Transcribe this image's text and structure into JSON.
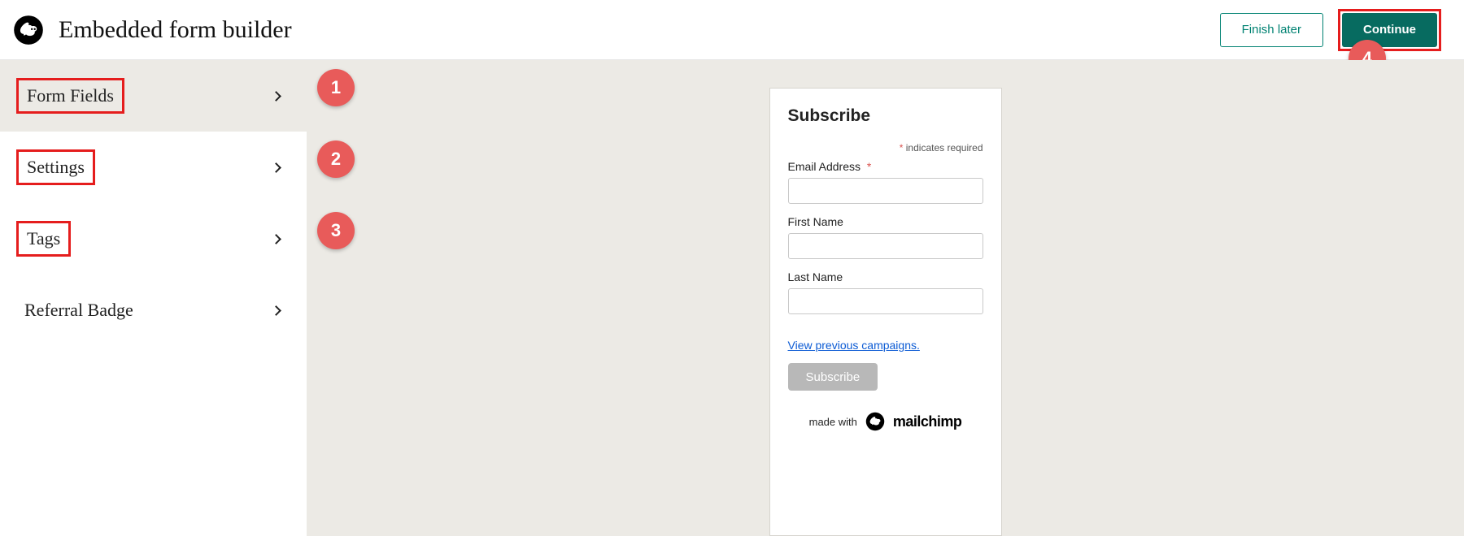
{
  "header": {
    "title": "Embedded form builder",
    "finish_label": "Finish later",
    "continue_label": "Continue"
  },
  "sidebar": {
    "items": [
      {
        "label": "Form Fields",
        "boxed": true,
        "active": true
      },
      {
        "label": "Settings",
        "boxed": true
      },
      {
        "label": "Tags",
        "boxed": true
      },
      {
        "label": "Referral Badge",
        "boxed": false
      }
    ]
  },
  "callouts": {
    "c1": "1",
    "c2": "2",
    "c3": "3",
    "c4": "4"
  },
  "preview": {
    "title": "Subscribe",
    "indicates_required": "indicates required",
    "fields": {
      "email_label": "Email Address",
      "email_required": true,
      "first_label": "First Name",
      "last_label": "Last Name"
    },
    "prev_campaigns": "View previous campaigns.",
    "subscribe_label": "Subscribe",
    "made_with": "made with",
    "brand": "mailchimp"
  },
  "colors": {
    "teal": "#008272",
    "badge": "#e85b5a",
    "highlight_box": "#e51d1d"
  }
}
